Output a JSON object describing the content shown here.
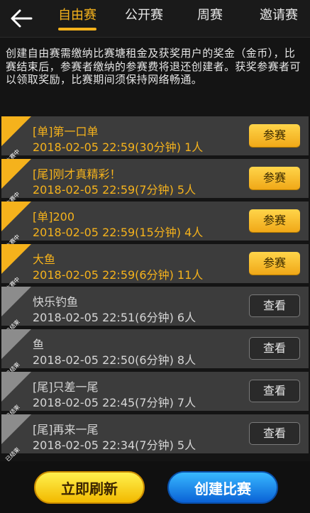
{
  "header": {
    "tabs": [
      {
        "label": "自由赛",
        "active": true
      },
      {
        "label": "公开赛",
        "active": false
      },
      {
        "label": "周赛",
        "active": false
      },
      {
        "label": "邀请赛",
        "active": false
      }
    ],
    "accent_color": "#f5b21c"
  },
  "description": "创建自由赛需缴纳比赛塘租金及获奖用户的奖金（金币），比赛结束后，参赛者缴纳的参赛费将退还创建者。获奖参赛者可以领取奖励，比赛期间须保持网络畅通。",
  "matches": [
    {
      "status": "比赛中",
      "title": "[单]第一口单",
      "info": "2018-02-05 22:59(30分钟) 1人",
      "button": "参赛"
    },
    {
      "status": "比赛中",
      "title": "[尾]刚才真精彩！",
      "info": "2018-02-05 22:59(7分钟) 5人",
      "button": "参赛"
    },
    {
      "status": "比赛中",
      "title": "[单]200",
      "info": "2018-02-05 22:59(15分钟) 4人",
      "button": "参赛"
    },
    {
      "status": "比赛中",
      "title": "大鱼",
      "info": "2018-02-05 22:59(6分钟) 11人",
      "button": "参赛"
    },
    {
      "status": "已结束",
      "title": "快乐钓鱼",
      "info": "2018-02-05 22:51(6分钟) 6人",
      "button": "查看"
    },
    {
      "status": "已结束",
      "title": "鱼",
      "info": "2018-02-05 22:50(6分钟) 8人",
      "button": "查看"
    },
    {
      "status": "已结束",
      "title": "[尾]只差一尾",
      "info": "2018-02-05 22:45(7分钟) 7人",
      "button": "查看"
    },
    {
      "status": "已结束",
      "title": "[尾]再来一尾",
      "info": "2018-02-05 22:34(7分钟) 5人",
      "button": "查看"
    }
  ],
  "footer": {
    "refresh_label": "立即刷新",
    "create_label": "创建比赛"
  }
}
